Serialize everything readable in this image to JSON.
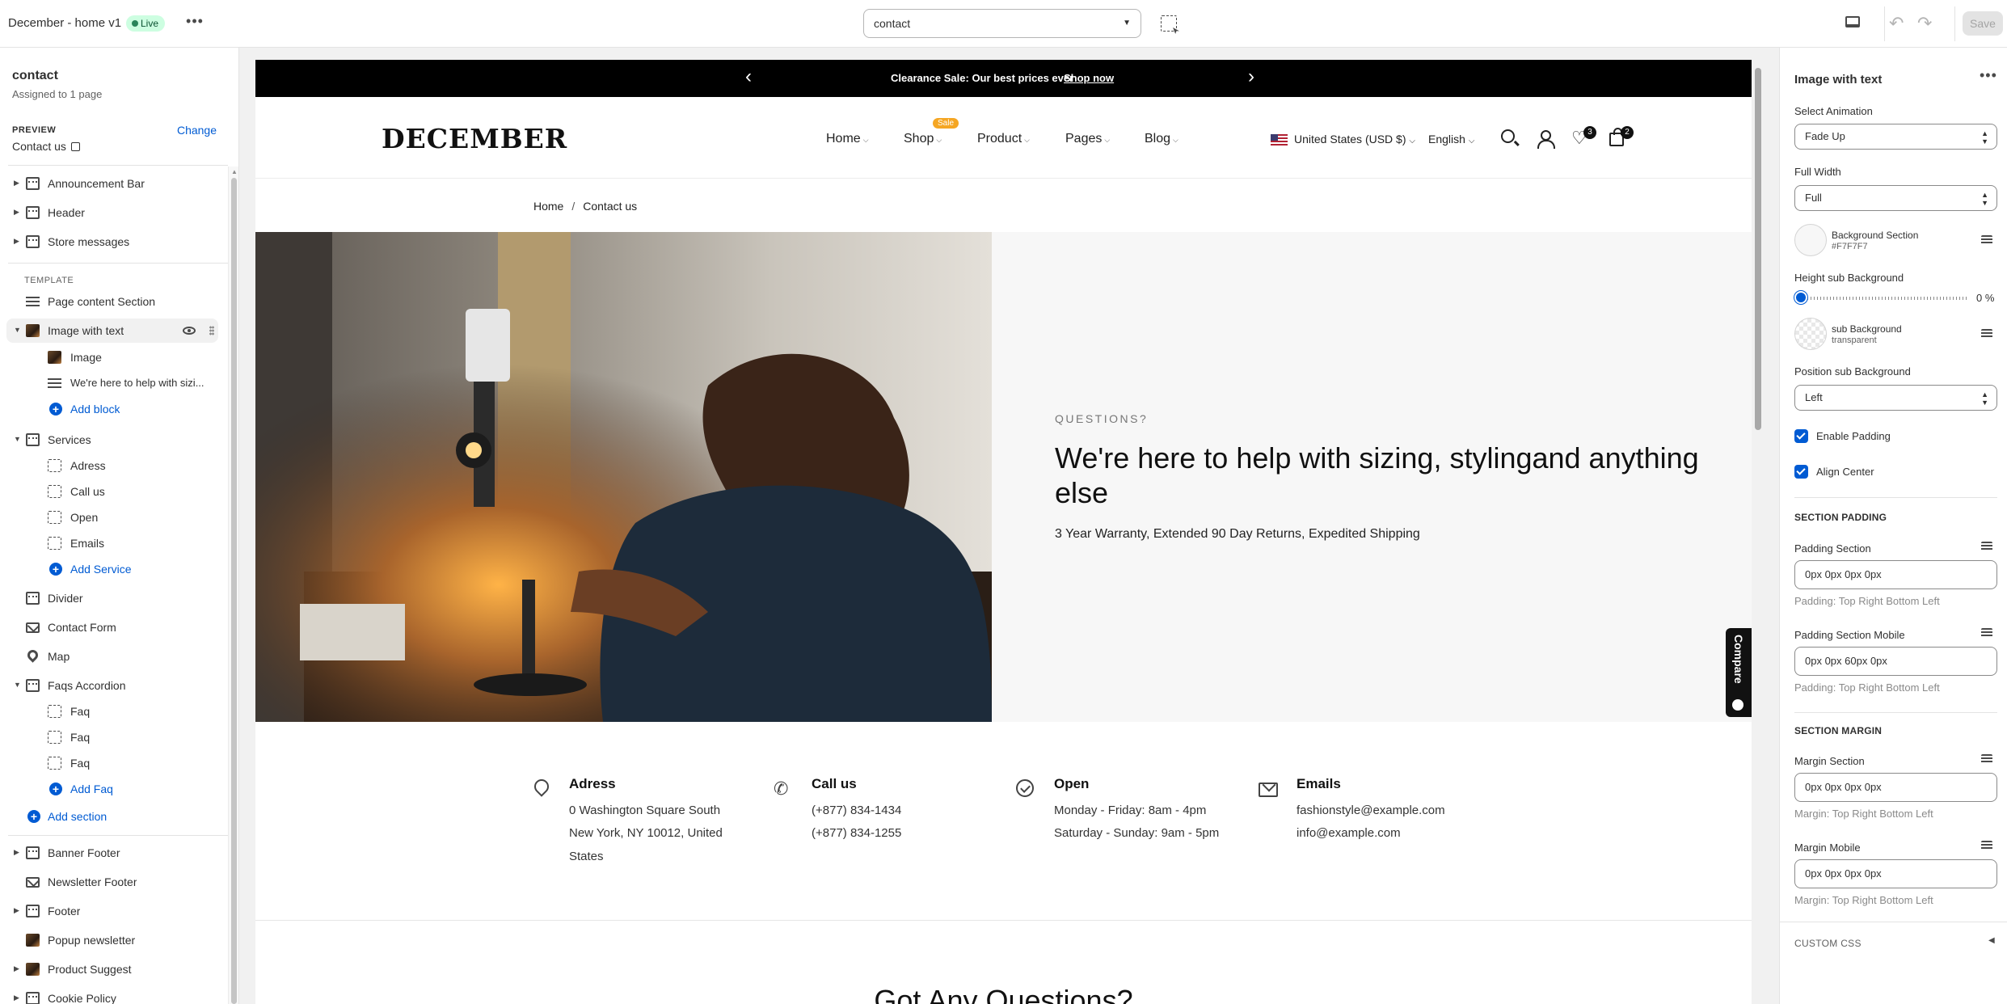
{
  "topbar": {
    "title": "December - home v1",
    "live_badge": "Live",
    "more": "•••",
    "page_select": "contact",
    "save_label": "Save"
  },
  "left": {
    "template_name": "contact",
    "assigned": "Assigned to 1 page",
    "preview_label": "PREVIEW",
    "change_label": "Change",
    "preview_value": "Contact us",
    "header_group": [
      "Announcement Bar",
      "Header",
      "Store messages"
    ],
    "template_label": "TEMPLATE",
    "page_content": "Page content Section",
    "image_with_text": "Image with text",
    "iwt_blocks": [
      "Image",
      "We're here to help with sizi..."
    ],
    "add_block": "Add block",
    "services": "Services",
    "service_blocks": [
      "Adress",
      "Call us",
      "Open",
      "Emails"
    ],
    "add_service": "Add Service",
    "divider": "Divider",
    "contact_form": "Contact Form",
    "map": "Map",
    "faqs": "Faqs Accordion",
    "faq_blocks": [
      "Faq",
      "Faq",
      "Faq"
    ],
    "add_faq": "Add Faq",
    "add_section": "Add section",
    "footer_group": [
      "Banner Footer",
      "Newsletter Footer",
      "Footer",
      "Popup newsletter",
      "Product Suggest",
      "Cookie Policy"
    ]
  },
  "preview": {
    "announcement": "Clearance Sale: Our best prices ever",
    "announcement_link": "Shop now",
    "logo": "DECEMBER",
    "nav": [
      "Home",
      "Shop",
      "Product",
      "Pages",
      "Blog"
    ],
    "sale_badge": "Sale",
    "currency": "United States (USD $)",
    "language": "English",
    "wishlist_count": "3",
    "cart_count": "2",
    "breadcrumb": [
      "Home",
      "/",
      "Contact us"
    ],
    "kicker": "QUESTIONS?",
    "heading": "We're here to help with sizing, stylingand anything else",
    "subheading": "3 Year Warranty, Extended 90 Day Returns, Expedited Shipping",
    "compare": "Compare",
    "services": [
      {
        "title": "Adress",
        "lines": [
          "0 Washington Square South",
          "New York, NY 10012, United",
          "States"
        ]
      },
      {
        "title": "Call us",
        "lines": [
          "(+877) 834-1434",
          "(+877) 834-1255"
        ]
      },
      {
        "title": "Open",
        "lines": [
          "Monday - Friday: 8am - 4pm",
          "Saturday - Sunday: 9am - 5pm"
        ]
      },
      {
        "title": "Emails",
        "lines": [
          "fashionstyle@example.com",
          "info@example.com"
        ]
      }
    ],
    "faq_heading": "Got Any Questions?"
  },
  "right": {
    "title": "Image with text",
    "select_animation_label": "Select Animation",
    "select_animation_value": "Fade Up",
    "full_width_label": "Full Width",
    "full_width_value": "Full",
    "bg_section_label": "Background Section",
    "bg_section_value": "#F7F7F7",
    "height_sub_bg_label": "Height sub Background",
    "height_sub_bg_value": "0 %",
    "height_sub_bg_fraction": 0,
    "sub_bg_label": "sub Background",
    "sub_bg_value": "transparent",
    "position_sub_bg_label": "Position sub Background",
    "position_sub_bg_value": "Left",
    "enable_padding": "Enable Padding",
    "align_center": "Align Center",
    "section_padding": "SECTION PADDING",
    "padding_section_label": "Padding Section",
    "padding_section_value": "0px 0px 0px 0px",
    "padding_help": "Padding: Top Right Bottom Left",
    "padding_mobile_label": "Padding Section Mobile",
    "padding_mobile_value": "0px 0px 60px 0px",
    "section_margin": "SECTION MARGIN",
    "margin_section_label": "Margin Section",
    "margin_section_value": "0px 0px 0px 0px",
    "margin_help": "Margin: Top Right Bottom Left",
    "margin_mobile_label": "Margin Mobile",
    "margin_mobile_value": "0px 0px 0px 0px",
    "custom_css": "CUSTOM CSS"
  },
  "colors": {
    "accent": "#005bd3",
    "announcement_bg": "#000000",
    "section_bg": "#F7F7F7",
    "sale_badge": "#f5a623"
  }
}
